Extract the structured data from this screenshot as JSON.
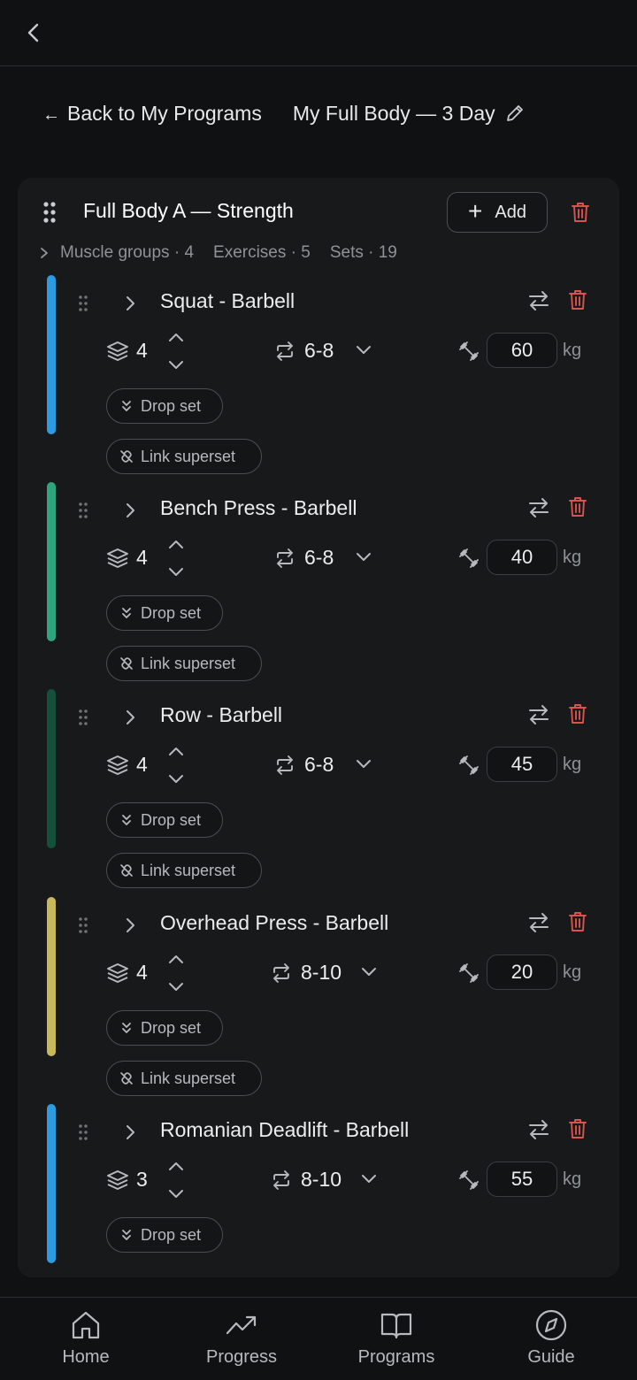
{
  "header": {
    "back_arrow": "←",
    "back_label": "Back to My Programs",
    "program_title": "My Full Body — 3 Day"
  },
  "day": {
    "title": "Full Body A — Strength",
    "add_label": "Add",
    "add_symbol": "+",
    "stats": {
      "muscle_groups": "Muscle groups · 4",
      "exercises": "Exercises · 5",
      "sets": "Sets · 19"
    }
  },
  "exercises": [
    {
      "name": "Squat - Barbell",
      "sets": "4",
      "reps": "6-8",
      "weight": "60",
      "unit": "kg",
      "drop_label": "Drop set",
      "link_label": "Link superset",
      "color": "#2d9be0"
    },
    {
      "name": "Bench Press - Barbell",
      "sets": "4",
      "reps": "6-8",
      "weight": "40",
      "unit": "kg",
      "drop_label": "Drop set",
      "link_label": "Link superset",
      "color": "#2fa57d"
    },
    {
      "name": "Row - Barbell",
      "sets": "4",
      "reps": "6-8",
      "weight": "45",
      "unit": "kg",
      "drop_label": "Drop set",
      "link_label": "Link superset",
      "color": "#14503a"
    },
    {
      "name": "Overhead Press - Barbell",
      "sets": "4",
      "reps": "8-10",
      "weight": "20",
      "unit": "kg",
      "drop_label": "Drop set",
      "link_label": "Link superset",
      "color": "#c8b85c"
    },
    {
      "name": "Romanian Deadlift - Barbell",
      "sets": "3",
      "reps": "8-10",
      "weight": "55",
      "unit": "kg",
      "drop_label": "Drop set",
      "color": "#2d9be0"
    }
  ],
  "nav": {
    "home": "Home",
    "progress": "Progress",
    "programs": "Programs",
    "guide": "Guide"
  },
  "colors": {
    "accent_red": "#d9534f",
    "background": "#0f1112",
    "card": "#17191b",
    "muted_text": "#8e9396"
  },
  "icons": [
    "chevron-left-icon",
    "pencil-icon",
    "grip-icon",
    "plus-icon",
    "trash-icon",
    "swap-icon",
    "layers-icon",
    "repeat-icon",
    "dumbbell-icon",
    "chevron-up-icon",
    "chevron-down-icon",
    "chevrons-down-icon",
    "unlink-icon",
    "home-icon",
    "trending-up-icon",
    "book-icon",
    "compass-icon"
  ]
}
